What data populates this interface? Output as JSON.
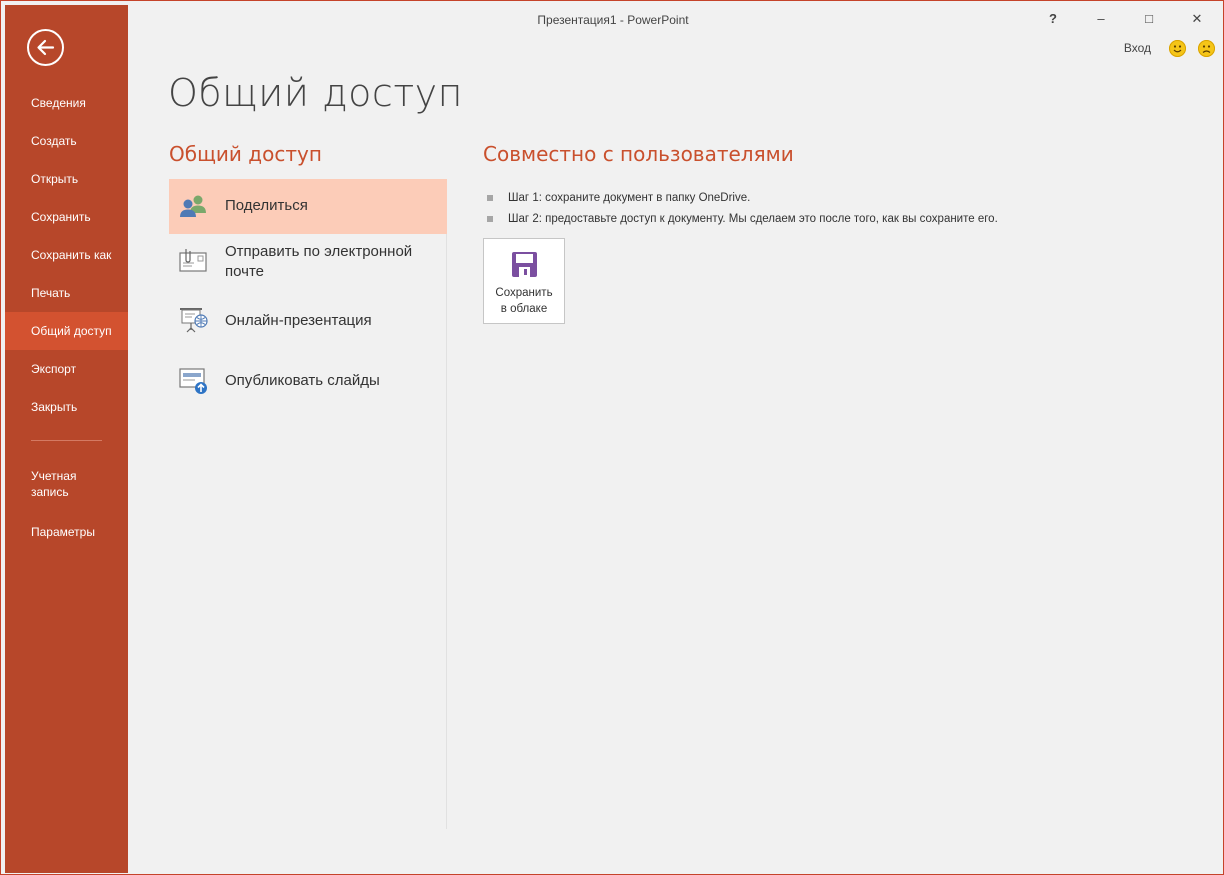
{
  "window": {
    "title": "Презентация1 - PowerPoint"
  },
  "controls": {
    "help": "?",
    "minimize": "–",
    "restore": "□",
    "close": "✕",
    "signin": "Вход"
  },
  "sidebar": {
    "items": [
      {
        "label": "Сведения"
      },
      {
        "label": "Создать"
      },
      {
        "label": "Открыть"
      },
      {
        "label": "Сохранить"
      },
      {
        "label": "Сохранить как"
      },
      {
        "label": "Печать"
      },
      {
        "label": "Общий доступ",
        "active": true
      },
      {
        "label": "Экспорт"
      },
      {
        "label": "Закрыть"
      }
    ],
    "footer_items": [
      {
        "label": "Учетная запись"
      },
      {
        "label": "Параметры"
      }
    ]
  },
  "main": {
    "page_title": "Общий доступ",
    "section_title": "Общий доступ",
    "options": [
      {
        "label": "Поделиться",
        "icon": "people-icon",
        "active": true
      },
      {
        "label": "Отправить по электронной почте",
        "icon": "email-attachment-icon"
      },
      {
        "label": "Онлайн-презентация",
        "icon": "online-presentation-icon"
      },
      {
        "label": "Опубликовать слайды",
        "icon": "publish-slides-icon"
      }
    ],
    "right_title": "Совместно с пользователями",
    "steps": [
      "Шаг 1: сохраните документ в папку OneDrive.",
      "Шаг 2: предоставьте доступ к документу. Мы сделаем это после того, как вы сохраните его."
    ],
    "save_button": {
      "line1": "Сохранить",
      "line2": "в облаке",
      "icon": "floppy-disk-icon"
    }
  },
  "colors": {
    "accent": "#b7472a",
    "active_nav": "#d35230",
    "active_option": "#fcccb8",
    "heading": "#c9502d",
    "save_icon": "#7b4fa0"
  }
}
